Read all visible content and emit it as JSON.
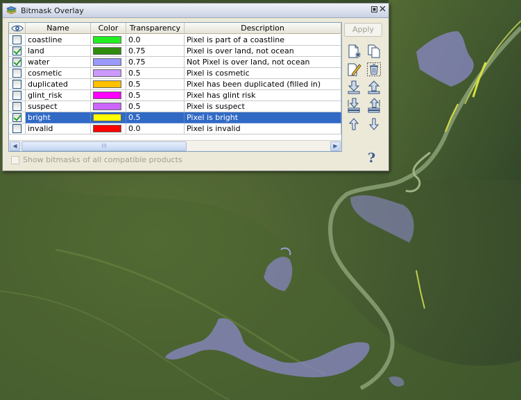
{
  "window": {
    "title": "Bitmask Overlay",
    "float_icon": "float-icon",
    "close_icon": "close-icon"
  },
  "table": {
    "columns": [
      "eye-icon",
      "Name",
      "Color",
      "Transparency",
      "Description"
    ],
    "headers": {
      "visible": "eye-icon",
      "name": "Name",
      "color": "Color",
      "transparency": "Transparency",
      "description": "Description"
    },
    "rows": [
      {
        "checked": false,
        "name": "coastline",
        "color": "#22ee22",
        "transparency": "0.0",
        "description": "Pixel is part of a coastline",
        "selected": false
      },
      {
        "checked": true,
        "name": "land",
        "color": "#2e8b0e",
        "transparency": "0.75",
        "description": "Pixel is over land, not ocean",
        "selected": false
      },
      {
        "checked": true,
        "name": "water",
        "color": "#9999ff",
        "transparency": "0.75",
        "description": "Not Pixel is over land, not ocean",
        "selected": false
      },
      {
        "checked": false,
        "name": "cosmetic",
        "color": "#cc99ff",
        "transparency": "0.5",
        "description": "Pixel is cosmetic",
        "selected": false
      },
      {
        "checked": false,
        "name": "duplicated",
        "color": "#ffc000",
        "transparency": "0.5",
        "description": "Pixel has been duplicated (filled in)",
        "selected": false
      },
      {
        "checked": false,
        "name": "glint_risk",
        "color": "#ff00ff",
        "transparency": "0.5",
        "description": "Pixel has glint risk",
        "selected": false
      },
      {
        "checked": false,
        "name": "suspect",
        "color": "#cc66ff",
        "transparency": "0.5",
        "description": "Pixel is suspect",
        "selected": false
      },
      {
        "checked": true,
        "name": "bright",
        "color": "#ffff00",
        "transparency": "0.5",
        "description": "Pixel is bright",
        "selected": true
      },
      {
        "checked": false,
        "name": "invalid",
        "color": "#ff0000",
        "transparency": "0.0",
        "description": "Pixel is invalid",
        "selected": false
      }
    ],
    "scroll_thumb_glyph": "III"
  },
  "toolbar": {
    "apply_label": "Apply",
    "buttons": [
      "new-mask-icon",
      "copy-mask-icon",
      "edit-mask-icon",
      "delete-mask-icon",
      "import-mask-icon",
      "export-mask-icon",
      "import-multiple-icon",
      "export-multiple-icon",
      "move-up-icon",
      "move-down-icon"
    ]
  },
  "footer": {
    "show_all_label": "Show bitmasks of all compatible products",
    "help_glyph": "?"
  },
  "colors": {
    "selection": "#316ac5",
    "window_bg": "#ece9d8",
    "map_base": "#3f5a2a"
  }
}
